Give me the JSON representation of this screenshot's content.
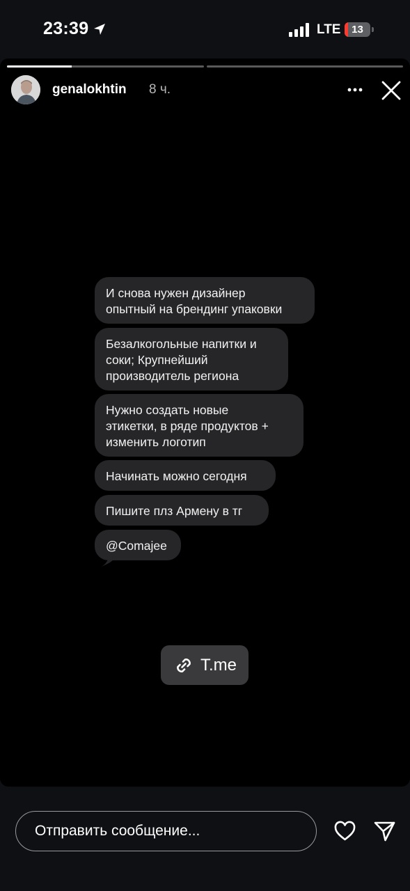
{
  "status_bar": {
    "time": "23:39",
    "network": "LTE",
    "battery_level": "13",
    "battery_fraction": 0.13,
    "icons": [
      "location-arrow-icon",
      "signal-icon",
      "battery-icon"
    ]
  },
  "story": {
    "progress": {
      "segments": 2,
      "current_segment": 1,
      "current_fill": 0.33
    },
    "username": "genalokhtin",
    "time_ago": "8 ч.",
    "icons": [
      "more-icon",
      "close-icon",
      "link-icon",
      "heart-icon",
      "send-icon"
    ],
    "messages": [
      {
        "lines": [
          "И снова нужен дизайнер",
          "опытный на брендинг упаковки"
        ]
      },
      {
        "lines": [
          "Безалкогольные напитки и",
          "соки; Крупнейший",
          "производитель региона"
        ]
      },
      {
        "lines": [
          "Нужно создать новые",
          "этикетки, в ряде продуктов +",
          "изменить логотип"
        ]
      },
      {
        "lines": [
          "Начинать можно сегодня"
        ]
      },
      {
        "lines": [
          "Пишите плз Армену в тг"
        ]
      },
      {
        "lines": [
          "@Comajee"
        ]
      }
    ],
    "link_sticker": {
      "label": "T.me"
    }
  },
  "reply": {
    "placeholder": "Отправить сообщение..."
  }
}
